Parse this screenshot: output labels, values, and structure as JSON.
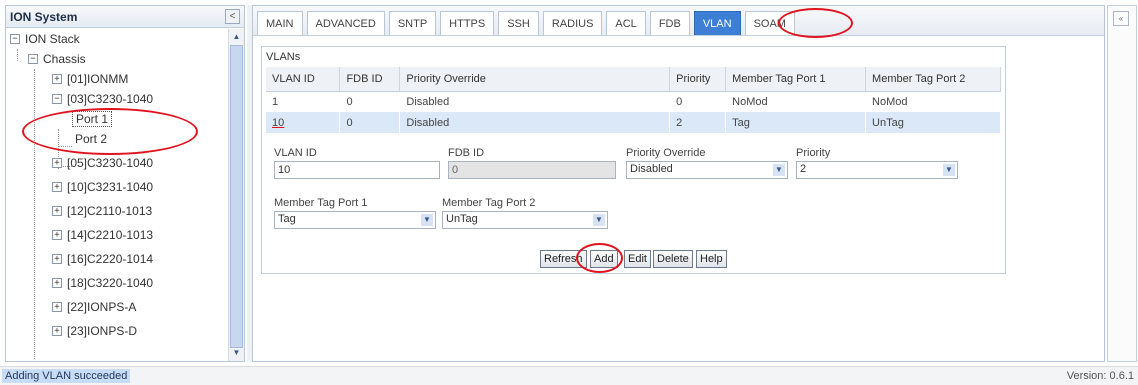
{
  "left": {
    "title": "ION System",
    "collapse_glyph": "<",
    "tree": {
      "root": "ION Stack",
      "chassis": "Chassis",
      "items": [
        "[01]IONMM",
        "[03]C3230-1040",
        "Port 1",
        "Port 2",
        "[05]C3230-1040",
        "[10]C3231-1040",
        "[12]C2110-1013",
        "[14]C2210-1013",
        "[16]C2220-1014",
        "[18]C3220-1040",
        "[22]IONPS-A",
        "[23]IONPS-D"
      ]
    }
  },
  "tabs": [
    "MAIN",
    "ADVANCED",
    "SNTP",
    "HTTPS",
    "SSH",
    "RADIUS",
    "ACL",
    "FDB",
    "VLAN",
    "SOAM"
  ],
  "active_tab": "VLAN",
  "vlans": {
    "group_label": "VLANs",
    "columns": [
      "VLAN ID",
      "FDB ID",
      "Priority Override",
      "Priority",
      "Member Tag Port 1",
      "Member Tag Port 2"
    ],
    "rows": [
      [
        "1",
        "0",
        "Disabled",
        "0",
        "NoMod",
        "NoMod"
      ],
      [
        "10",
        "0",
        "Disabled",
        "2",
        "Tag",
        "UnTag"
      ]
    ]
  },
  "form": {
    "vlan_id_label": "VLAN ID",
    "vlan_id_value": "10",
    "fdb_id_label": "FDB ID",
    "fdb_id_value": "0",
    "priority_override_label": "Priority Override",
    "priority_override_value": "Disabled",
    "priority_label": "Priority",
    "priority_value": "2",
    "member_tag_port1_label": "Member Tag Port 1",
    "member_tag_port1_value": "Tag",
    "member_tag_port2_label": "Member Tag Port 2",
    "member_tag_port2_value": "UnTag"
  },
  "buttons": {
    "refresh": "Refresh",
    "add": "Add",
    "edit": "Edit",
    "delete": "Delete",
    "help": "Help"
  },
  "status": {
    "message": "Adding VLAN succeeded",
    "version": "Version: 0.6.1"
  },
  "colors": {
    "active_tab": "#3d7fd4",
    "annotation": "#e0141e",
    "selected_row": "#dbe8f8"
  }
}
